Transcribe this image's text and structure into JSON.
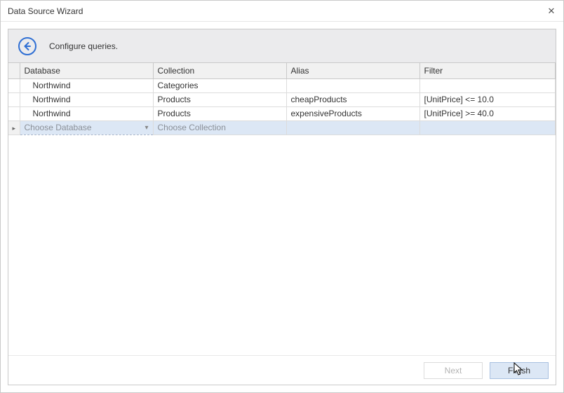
{
  "window": {
    "title": "Data Source Wizard",
    "close_symbol": "✕"
  },
  "header": {
    "subtitle": "Configure queries."
  },
  "grid": {
    "columns": {
      "database": "Database",
      "collection": "Collection",
      "alias": "Alias",
      "filter": "Filter"
    },
    "rows": [
      {
        "database": "Northwind",
        "collection": "Categories",
        "alias": "",
        "filter": ""
      },
      {
        "database": "Northwind",
        "collection": "Products",
        "alias": "cheapProducts",
        "filter": "[UnitPrice] <= 10.0"
      },
      {
        "database": "Northwind",
        "collection": "Products",
        "alias": "expensiveProducts",
        "filter": "[UnitPrice] >= 40.0"
      }
    ],
    "new_row": {
      "marker": "▸",
      "database_placeholder": "Choose Database",
      "collection_placeholder": "Choose Collection"
    }
  },
  "footer": {
    "next": "Next",
    "finish": "Finish"
  }
}
